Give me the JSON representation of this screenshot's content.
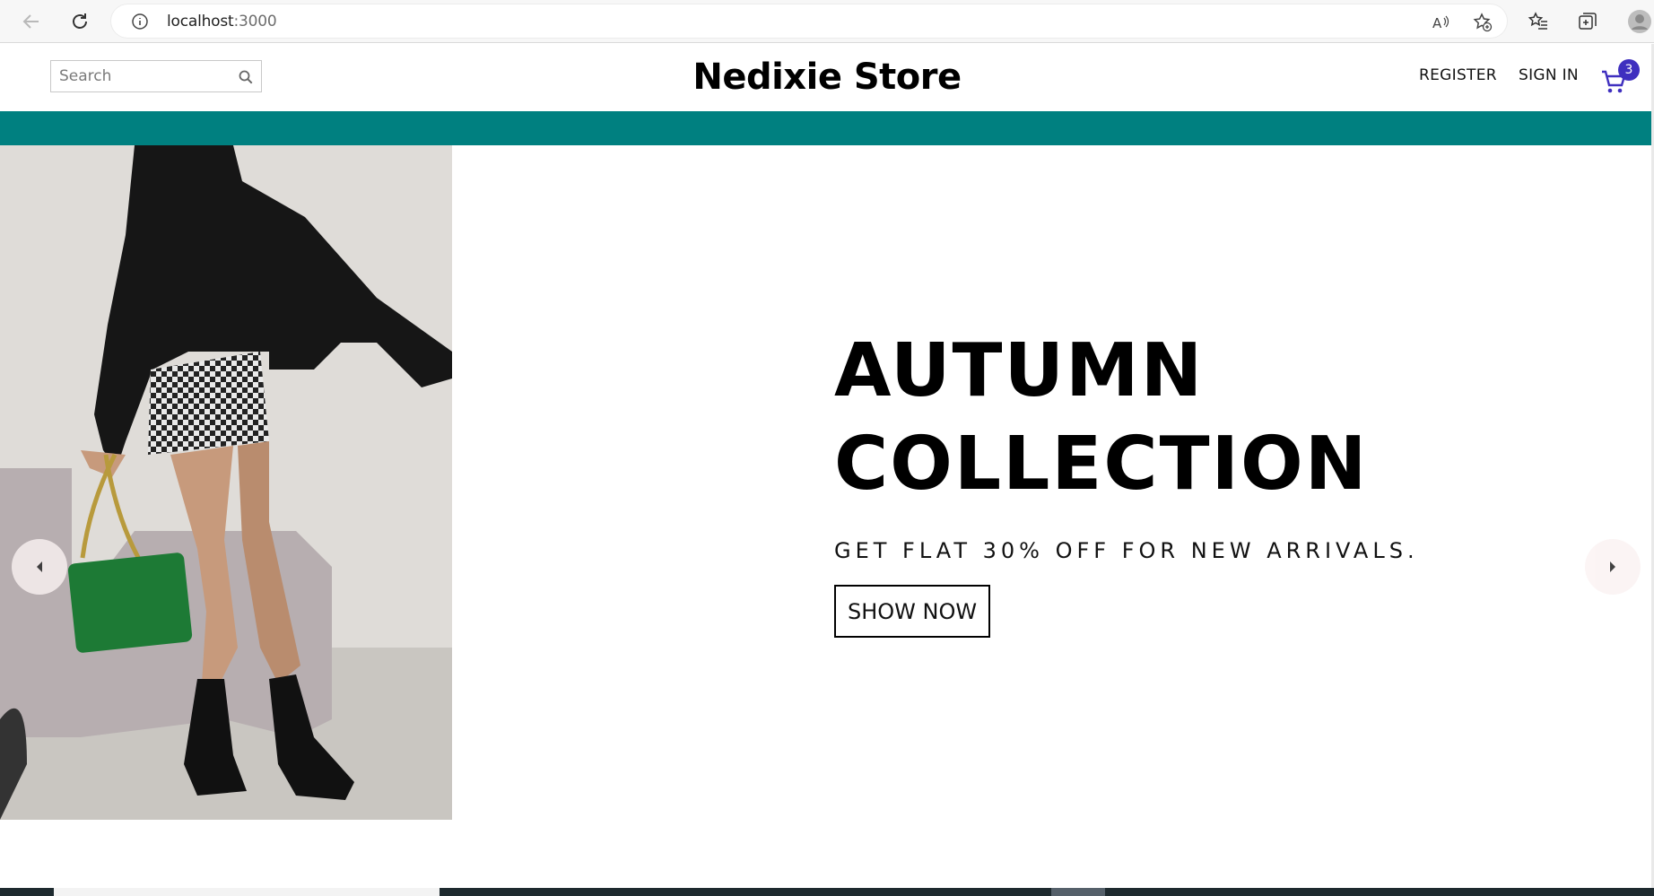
{
  "browser": {
    "url_host": "localhost",
    "url_port": ":3000"
  },
  "header": {
    "search_placeholder": "Search",
    "brand": "Nedixie Store",
    "register_label": "REGISTER",
    "signin_label": "SIGN IN",
    "cart_count": "3"
  },
  "hero": {
    "title_line1": "AUTUMN",
    "title_line2": "COLLECTION",
    "description": "GET FLAT 30% OFF FOR NEW ARRIVALS.",
    "button_label": "SHOW NOW"
  },
  "colors": {
    "announce_bar": "#008080",
    "cart_badge": "#3f2fbf",
    "cart_icon": "#3f2fbf"
  },
  "icons": {
    "back": "arrow-left-icon",
    "reload": "reload-icon",
    "info": "info-icon",
    "read_aloud": "read-aloud-icon",
    "favorite_add": "star-plus-icon",
    "favorites": "favorites-icon",
    "collections": "collections-icon",
    "profile": "profile-icon",
    "search": "search-icon",
    "cart": "shopping-cart-icon",
    "prev": "caret-left-icon",
    "next": "caret-right-icon"
  }
}
